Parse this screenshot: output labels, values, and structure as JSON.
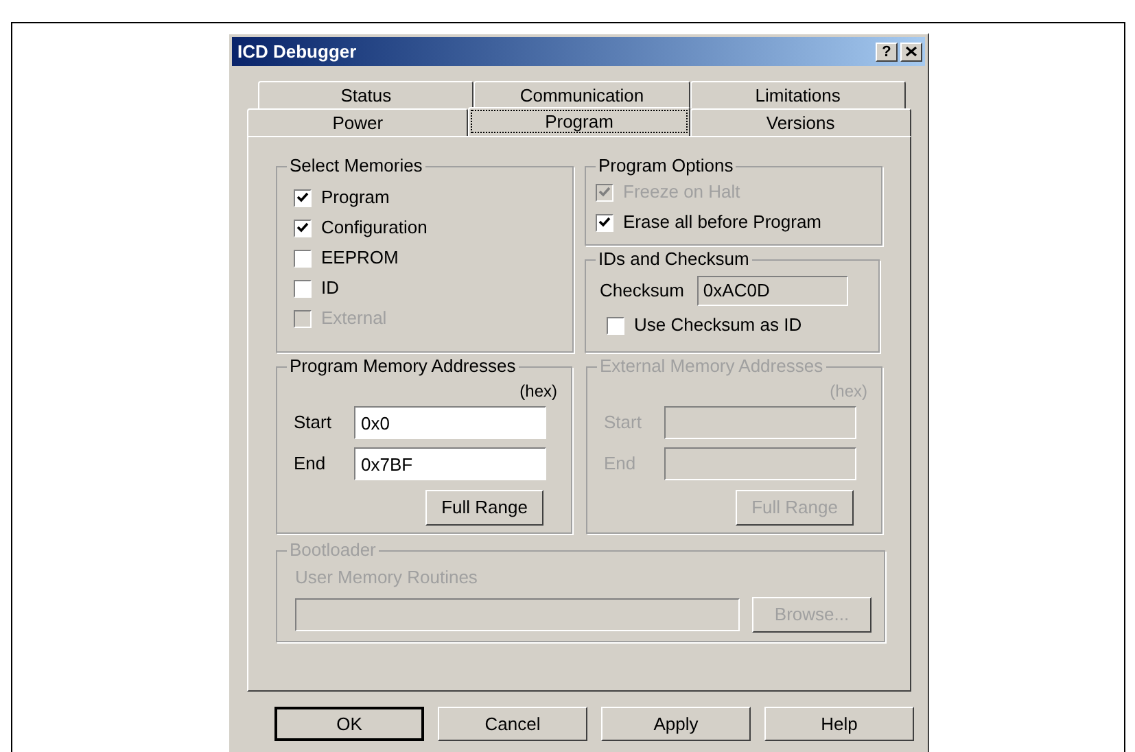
{
  "window": {
    "title": "ICD Debugger",
    "help_glyph": "?"
  },
  "tab_rows": [
    [
      {
        "label": "Status",
        "selected": false
      },
      {
        "label": "Communication",
        "selected": false
      },
      {
        "label": "Limitations",
        "selected": false
      }
    ],
    [
      {
        "label": "Power",
        "selected": false
      },
      {
        "label": "Program",
        "selected": true
      },
      {
        "label": "Versions",
        "selected": false
      }
    ]
  ],
  "select_memories": {
    "title": "Select Memories",
    "items": [
      {
        "label": "Program",
        "checked": true,
        "disabled": false
      },
      {
        "label": "Configuration",
        "checked": true,
        "disabled": false
      },
      {
        "label": "EEPROM",
        "checked": false,
        "disabled": false
      },
      {
        "label": "ID",
        "checked": false,
        "disabled": false
      },
      {
        "label": "External",
        "checked": false,
        "disabled": true
      }
    ]
  },
  "program_options": {
    "title": "Program Options",
    "items": [
      {
        "label": "Freeze on Halt",
        "checked": true,
        "disabled": true
      },
      {
        "label": "Erase all before Program",
        "checked": true,
        "disabled": false
      }
    ]
  },
  "ids_and_checksum": {
    "title": "IDs and Checksum",
    "checksum_label": "Checksum",
    "checksum_value": "0xAC0D",
    "use_checksum": {
      "label": "Use Checksum as ID",
      "checked": false,
      "disabled": false
    }
  },
  "address_groups": [
    {
      "title": "Program Memory Addresses",
      "unit": "(hex)",
      "disabled": false,
      "start_label": "Start",
      "start_value": "0x0",
      "end_label": "End",
      "end_value": "0x7BF",
      "button": "Full Range"
    },
    {
      "title": "External Memory Addresses",
      "unit": "(hex)",
      "disabled": true,
      "start_label": "Start",
      "end_label": "End",
      "button": "Full Range"
    }
  ],
  "bootloader": {
    "title": "Bootloader",
    "label": "User Memory Routines",
    "button": "Browse...",
    "disabled": true
  },
  "buttons": [
    {
      "label": "OK",
      "default": true
    },
    {
      "label": "Cancel",
      "default": false
    },
    {
      "label": "Apply",
      "default": false
    },
    {
      "label": "Help",
      "default": false
    }
  ]
}
